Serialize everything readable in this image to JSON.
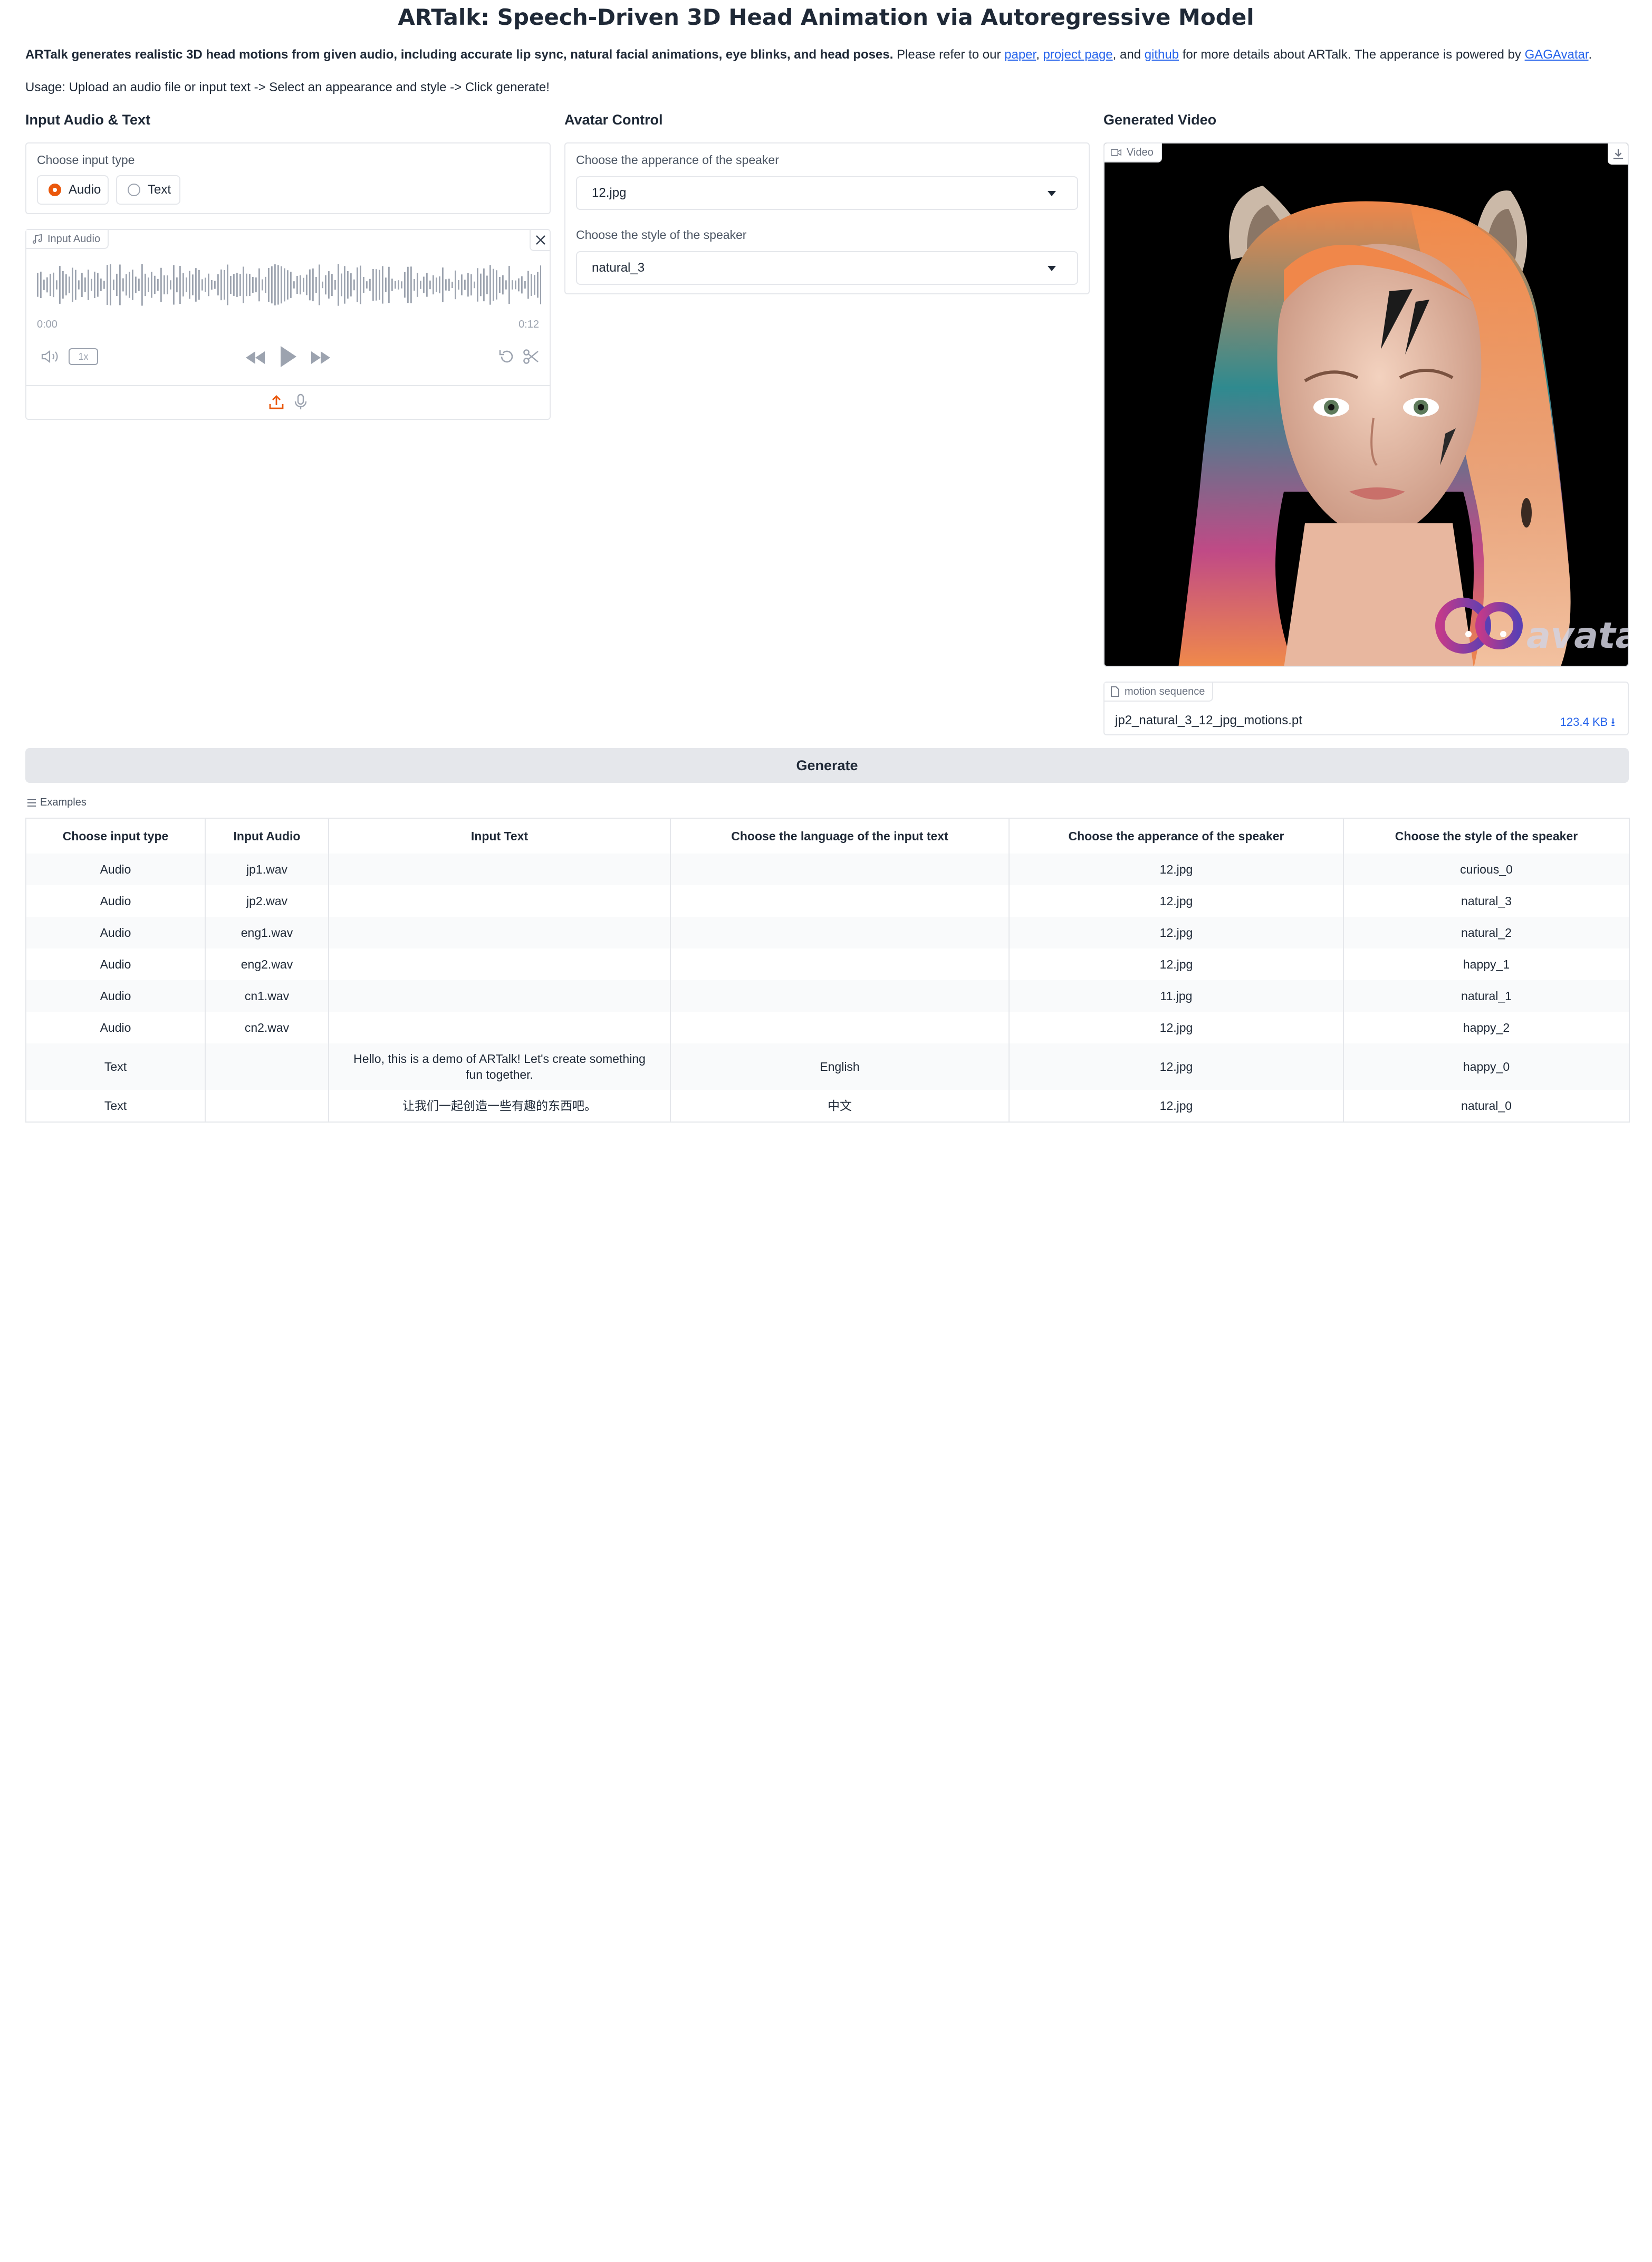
{
  "header": {
    "title": "ARTalk: Speech-Driven 3D Head Animation via Autoregressive Model",
    "desc_bold": "ARTalk generates realistic 3D head motions from given audio, including accurate lip sync, natural facial animations, eye blinks, and head poses.",
    "desc_pre": " Please refer to our ",
    "link_paper": "paper",
    "sep1": ", ",
    "link_project": "project page",
    "sep2": ", and ",
    "link_github": "github",
    "desc_mid": " for more details about ARTalk. The apperance is powered by ",
    "link_gag": "GAGAvatar",
    "desc_end": ".",
    "usage": "Usage: Upload an audio file or input text -> Select an appearance and style -> Click generate!"
  },
  "input_col": {
    "heading": "Input Audio & Text",
    "input_type_label": "Choose input type",
    "options": [
      "Audio",
      "Text"
    ],
    "selected": "Audio",
    "audio": {
      "tag": "Input Audio",
      "time_start": "0:00",
      "time_end": "0:12",
      "speed": "1x"
    }
  },
  "avatar_col": {
    "heading": "Avatar Control",
    "appearance_label": "Choose the apperance of the speaker",
    "appearance_value": "12.jpg",
    "style_label": "Choose the style of the speaker",
    "style_value": "natural_3"
  },
  "output_col": {
    "heading": "Generated Video",
    "video_tag": "Video",
    "video_watermark": "avatar",
    "file_tag": "motion sequence",
    "file_name": "jp2_natural_3_12_jpg_motions.pt",
    "file_size": "123.4 KB ⭳"
  },
  "generate_label": "Generate",
  "examples": {
    "label": "Examples",
    "columns": [
      "Choose input type",
      "Input Audio",
      "Input Text",
      "Choose the language of the input text",
      "Choose the apperance of the speaker",
      "Choose the style of the speaker"
    ],
    "rows": [
      [
        "Audio",
        "jp1.wav",
        "",
        "",
        "12.jpg",
        "curious_0"
      ],
      [
        "Audio",
        "jp2.wav",
        "",
        "",
        "12.jpg",
        "natural_3"
      ],
      [
        "Audio",
        "eng1.wav",
        "",
        "",
        "12.jpg",
        "natural_2"
      ],
      [
        "Audio",
        "eng2.wav",
        "",
        "",
        "12.jpg",
        "happy_1"
      ],
      [
        "Audio",
        "cn1.wav",
        "",
        "",
        "11.jpg",
        "natural_1"
      ],
      [
        "Audio",
        "cn2.wav",
        "",
        "",
        "12.jpg",
        "happy_2"
      ],
      [
        "Text",
        "",
        "Hello, this is a demo of ARTalk! Let's create something fun together.",
        "English",
        "12.jpg",
        "happy_0"
      ],
      [
        "Text",
        "",
        "让我们一起创造一些有趣的东西吧。",
        "中文",
        "12.jpg",
        "natural_0"
      ]
    ]
  },
  "colors": {
    "accent": "#ea580c",
    "link": "#2563eb",
    "button_bg": "#e5e7eb",
    "border": "#e5e7eb"
  }
}
